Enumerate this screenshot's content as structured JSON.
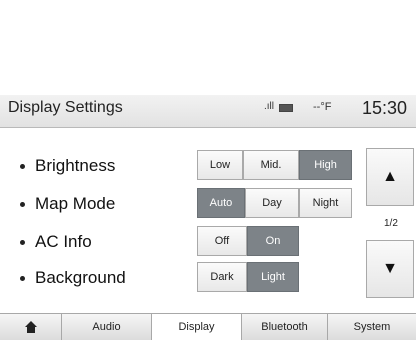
{
  "header": {
    "title": "Display Settings",
    "signal": ".ıll",
    "temperature": "--°F",
    "clock": "15:30"
  },
  "settings": {
    "brightness": {
      "label": "Brightness",
      "options": [
        "Low",
        "Mid.",
        "High"
      ],
      "selected": "High"
    },
    "map_mode": {
      "label": "Map Mode",
      "options": [
        "Auto",
        "Day",
        "Night"
      ],
      "selected": "Auto"
    },
    "ac_info": {
      "label": "AC Info",
      "options": [
        "Off",
        "On"
      ],
      "selected": "On"
    },
    "background": {
      "label": "Background",
      "options": [
        "Dark",
        "Light"
      ],
      "selected": "Light"
    }
  },
  "pagination": {
    "indicator": "1/2",
    "up_icon": "▲",
    "down_icon": "▼"
  },
  "tabs": {
    "home_icon": "home-icon",
    "items": [
      "Audio",
      "Display",
      "Bluetooth",
      "System"
    ],
    "active": "Display"
  },
  "colors": {
    "selected": "#7d8388",
    "header": "#e8e8e8"
  }
}
